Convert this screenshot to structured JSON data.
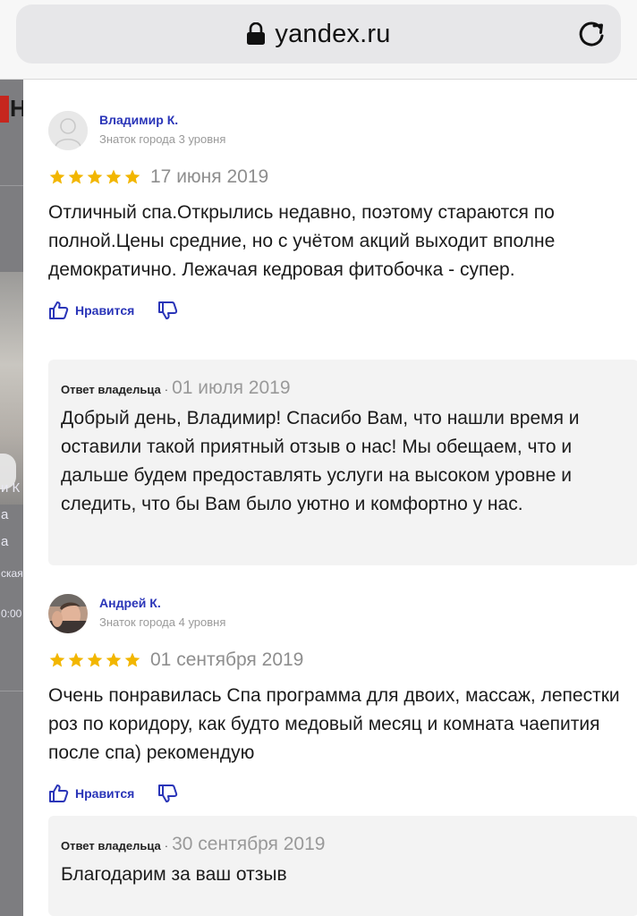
{
  "browser": {
    "url": "yandex.ru"
  },
  "background_page": {
    "logo_letter": "Н",
    "fragments": [
      "и К",
      "а",
      "а",
      "ская",
      "0:00"
    ]
  },
  "reviews": [
    {
      "author": "Владимир К.",
      "level": "Знаток города 3 уровня",
      "rating": 5,
      "date": "17 июня 2019",
      "text": "Отличный спа.Открылись недавно, поэтому стараются по полной.Цены средние, но с учётом акций выходит вполне демократично. Лежачая кедровая фитобочка - супер.",
      "like_label": "Нравится",
      "reply": {
        "who": "Ответ владельца",
        "separator": "·",
        "date": "01 июля 2019",
        "text": "Добрый день, Владимир! Спасибо Вам, что нашли время и оставили такой приятный отзыв о нас! Мы обещаем, что и дальше будем предоставлять услуги на высоком уровне и следить, что бы Вам было уютно и комфортно у нас."
      }
    },
    {
      "author": "Андрей К.",
      "level": "Знаток города 4 уровня",
      "rating": 5,
      "date": "01 сентября 2019",
      "text": "Очень понравилась Спа программа для двоих, массаж, лепестки роз по коридору, как будто медовый месяц и комната чаепития после спа) рекомендую",
      "like_label": "Нравится",
      "reply": {
        "who": "Ответ владельца",
        "separator": "·",
        "date": "30 сентября 2019",
        "text": "Благодарим за ваш отзыв"
      }
    }
  ],
  "colors": {
    "link_blue": "#2a35b8",
    "star_gold": "#f2b600",
    "muted_gray": "#8e8e8e",
    "reply_bg": "#f3f3f3"
  },
  "icons": [
    "lock-icon",
    "reload-icon",
    "star-icon",
    "thumbs-up-icon",
    "thumbs-down-icon",
    "default-avatar-icon",
    "user-photo-avatar"
  ]
}
